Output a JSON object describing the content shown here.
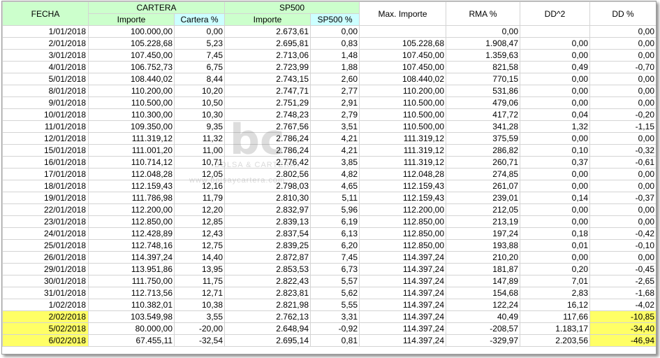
{
  "headers": {
    "fecha": "FECHA",
    "cartera": "CARTERA",
    "sp500": "SP500",
    "importe": "Importe",
    "cartera_pct": "Cartera %",
    "sp500_importe": "Importe",
    "sp500_pct": "SP500 %",
    "max_importe": "Max. Importe",
    "rma_pct": "RMA %",
    "dd2": "DD^2",
    "dd_pct": "DD %"
  },
  "watermark": {
    "logo": "bc",
    "line1": "BOLSA & CARTERA",
    "line2": "www.bolsaycartera.com"
  },
  "rows": [
    {
      "fecha": "1/01/2018",
      "importe": "100.000,00",
      "cartera_pct": "0,00",
      "sp_importe": "2.673,61",
      "sp_pct": "0,00",
      "max": "",
      "rma": "0,00",
      "dd2": "",
      "dd": "0,00"
    },
    {
      "fecha": "2/01/2018",
      "importe": "105.228,68",
      "cartera_pct": "5,23",
      "sp_importe": "2.695,81",
      "sp_pct": "0,83",
      "max": "105.228,68",
      "rma": "1.908,47",
      "dd2": "0,00",
      "dd": "0,00"
    },
    {
      "fecha": "3/01/2018",
      "importe": "107.450,00",
      "cartera_pct": "7,45",
      "sp_importe": "2.713,06",
      "sp_pct": "1,48",
      "max": "107.450,00",
      "rma": "1.359,63",
      "dd2": "0,00",
      "dd": "0,00"
    },
    {
      "fecha": "4/01/2018",
      "importe": "106.752,73",
      "cartera_pct": "6,75",
      "sp_importe": "2.723,99",
      "sp_pct": "1,88",
      "max": "107.450,00",
      "rma": "821,58",
      "dd2": "0,49",
      "dd": "-0,70"
    },
    {
      "fecha": "5/01/2018",
      "importe": "108.440,02",
      "cartera_pct": "8,44",
      "sp_importe": "2.743,15",
      "sp_pct": "2,60",
      "max": "108.440,02",
      "rma": "770,15",
      "dd2": "0,00",
      "dd": "0,00"
    },
    {
      "fecha": "8/01/2018",
      "importe": "110.200,00",
      "cartera_pct": "10,20",
      "sp_importe": "2.747,71",
      "sp_pct": "2,77",
      "max": "110.200,00",
      "rma": "531,86",
      "dd2": "0,00",
      "dd": "0,00"
    },
    {
      "fecha": "9/01/2018",
      "importe": "110.500,00",
      "cartera_pct": "10,50",
      "sp_importe": "2.751,29",
      "sp_pct": "2,91",
      "max": "110.500,00",
      "rma": "479,06",
      "dd2": "0,00",
      "dd": "0,00"
    },
    {
      "fecha": "10/01/2018",
      "importe": "110.300,00",
      "cartera_pct": "10,30",
      "sp_importe": "2.748,23",
      "sp_pct": "2,79",
      "max": "110.500,00",
      "rma": "417,72",
      "dd2": "0,04",
      "dd": "-0,20"
    },
    {
      "fecha": "11/01/2018",
      "importe": "109.350,00",
      "cartera_pct": "9,35",
      "sp_importe": "2.767,56",
      "sp_pct": "3,51",
      "max": "110.500,00",
      "rma": "341,28",
      "dd2": "1,32",
      "dd": "-1,15"
    },
    {
      "fecha": "12/01/2018",
      "importe": "111.319,12",
      "cartera_pct": "11,32",
      "sp_importe": "2.786,24",
      "sp_pct": "4,21",
      "max": "111.319,12",
      "rma": "375,59",
      "dd2": "0,00",
      "dd": "0,00"
    },
    {
      "fecha": "15/01/2018",
      "importe": "111.001,20",
      "cartera_pct": "11,00",
      "sp_importe": "2.786,24",
      "sp_pct": "4,21",
      "max": "111.319,12",
      "rma": "286,82",
      "dd2": "0,10",
      "dd": "-0,32"
    },
    {
      "fecha": "16/01/2018",
      "importe": "110.714,12",
      "cartera_pct": "10,71",
      "sp_importe": "2.776,42",
      "sp_pct": "3,85",
      "max": "111.319,12",
      "rma": "260,71",
      "dd2": "0,37",
      "dd": "-0,61"
    },
    {
      "fecha": "17/01/2018",
      "importe": "112.048,28",
      "cartera_pct": "12,05",
      "sp_importe": "2.802,56",
      "sp_pct": "4,82",
      "max": "112.048,28",
      "rma": "274,85",
      "dd2": "0,00",
      "dd": "0,00"
    },
    {
      "fecha": "18/01/2018",
      "importe": "112.159,43",
      "cartera_pct": "12,16",
      "sp_importe": "2.798,03",
      "sp_pct": "4,65",
      "max": "112.159,43",
      "rma": "261,07",
      "dd2": "0,00",
      "dd": "0,00"
    },
    {
      "fecha": "19/01/2018",
      "importe": "111.786,98",
      "cartera_pct": "11,79",
      "sp_importe": "2.810,30",
      "sp_pct": "5,11",
      "max": "112.159,43",
      "rma": "239,01",
      "dd2": "0,14",
      "dd": "-0,37"
    },
    {
      "fecha": "22/01/2018",
      "importe": "112.200,00",
      "cartera_pct": "12,20",
      "sp_importe": "2.832,97",
      "sp_pct": "5,96",
      "max": "112.200,00",
      "rma": "212,05",
      "dd2": "0,00",
      "dd": "0,00"
    },
    {
      "fecha": "23/01/2018",
      "importe": "112.850,00",
      "cartera_pct": "12,85",
      "sp_importe": "2.839,13",
      "sp_pct": "6,19",
      "max": "112.850,00",
      "rma": "213,19",
      "dd2": "0,00",
      "dd": "0,00"
    },
    {
      "fecha": "24/01/2018",
      "importe": "112.428,89",
      "cartera_pct": "12,43",
      "sp_importe": "2.837,54",
      "sp_pct": "6,13",
      "max": "112.850,00",
      "rma": "197,24",
      "dd2": "0,18",
      "dd": "-0,42"
    },
    {
      "fecha": "25/01/2018",
      "importe": "112.748,16",
      "cartera_pct": "12,75",
      "sp_importe": "2.839,25",
      "sp_pct": "6,20",
      "max": "112.850,00",
      "rma": "193,88",
      "dd2": "0,01",
      "dd": "-0,10"
    },
    {
      "fecha": "26/01/2018",
      "importe": "114.397,24",
      "cartera_pct": "14,40",
      "sp_importe": "2.872,87",
      "sp_pct": "7,45",
      "max": "114.397,24",
      "rma": "210,20",
      "dd2": "0,00",
      "dd": "0,00"
    },
    {
      "fecha": "29/01/2018",
      "importe": "113.951,86",
      "cartera_pct": "13,95",
      "sp_importe": "2.853,53",
      "sp_pct": "6,73",
      "max": "114.397,24",
      "rma": "181,87",
      "dd2": "0,20",
      "dd": "-0,45"
    },
    {
      "fecha": "30/01/2018",
      "importe": "111.750,00",
      "cartera_pct": "11,75",
      "sp_importe": "2.822,43",
      "sp_pct": "5,57",
      "max": "114.397,24",
      "rma": "147,89",
      "dd2": "7,01",
      "dd": "-2,65"
    },
    {
      "fecha": "31/01/2018",
      "importe": "112.713,56",
      "cartera_pct": "12,71",
      "sp_importe": "2.823,81",
      "sp_pct": "5,62",
      "max": "114.397,24",
      "rma": "154,68",
      "dd2": "2,83",
      "dd": "-1,68"
    },
    {
      "fecha": "1/02/2018",
      "importe": "110.382,01",
      "cartera_pct": "10,38",
      "sp_importe": "2.821,98",
      "sp_pct": "5,55",
      "max": "114.397,24",
      "rma": "122,24",
      "dd2": "16,12",
      "dd": "-4,02"
    },
    {
      "fecha": "2/02/2018",
      "importe": "103.549,98",
      "cartera_pct": "3,55",
      "sp_importe": "2.762,13",
      "sp_pct": "3,31",
      "max": "114.397,24",
      "rma": "40,49",
      "dd2": "117,66",
      "dd": "-10,85",
      "highlight": true
    },
    {
      "fecha": "5/02/2018",
      "importe": "80.000,00",
      "cartera_pct": "-20,00",
      "sp_importe": "2.648,94",
      "sp_pct": "-0,92",
      "max": "114.397,24",
      "rma": "-208,57",
      "dd2": "1.183,17",
      "dd": "-34,40",
      "highlight": true
    },
    {
      "fecha": "6/02/2018",
      "importe": "67.455,11",
      "cartera_pct": "-32,54",
      "sp_importe": "2.695,14",
      "sp_pct": "0,81",
      "max": "114.397,24",
      "rma": "-329,97",
      "dd2": "2.203,56",
      "dd": "-46,94",
      "highlight": true
    }
  ],
  "colors": {
    "header_green": "#ccffcc",
    "header_cyan": "#ccffff",
    "highlight_yellow": "#ffff66"
  }
}
